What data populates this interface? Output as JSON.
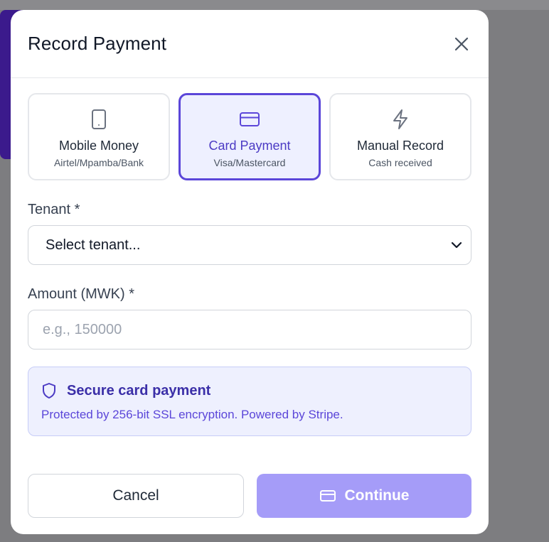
{
  "modal": {
    "title": "Record Payment"
  },
  "payment_methods": [
    {
      "title": "Mobile Money",
      "subtitle": "Airtel/Mpamba/Bank",
      "icon": "phone-icon",
      "selected": false
    },
    {
      "title": "Card Payment",
      "subtitle": "Visa/Mastercard",
      "icon": "credit-card-icon",
      "selected": true
    },
    {
      "title": "Manual Record",
      "subtitle": "Cash received",
      "icon": "lightning-icon",
      "selected": false
    }
  ],
  "tenant": {
    "label": "Tenant *",
    "selected_value": "Select tenant..."
  },
  "amount": {
    "label": "Amount (MWK) *",
    "value": "",
    "placeholder": "e.g., 150000"
  },
  "notice": {
    "title": "Secure card payment",
    "body": "Protected by 256-bit SSL encryption. Powered by Stripe."
  },
  "actions": {
    "cancel_label": "Cancel",
    "continue_label": "Continue"
  },
  "colors": {
    "accent": "#5b46d9",
    "accent_light": "#eef0ff",
    "continue_disabled": "#a59cf8"
  }
}
